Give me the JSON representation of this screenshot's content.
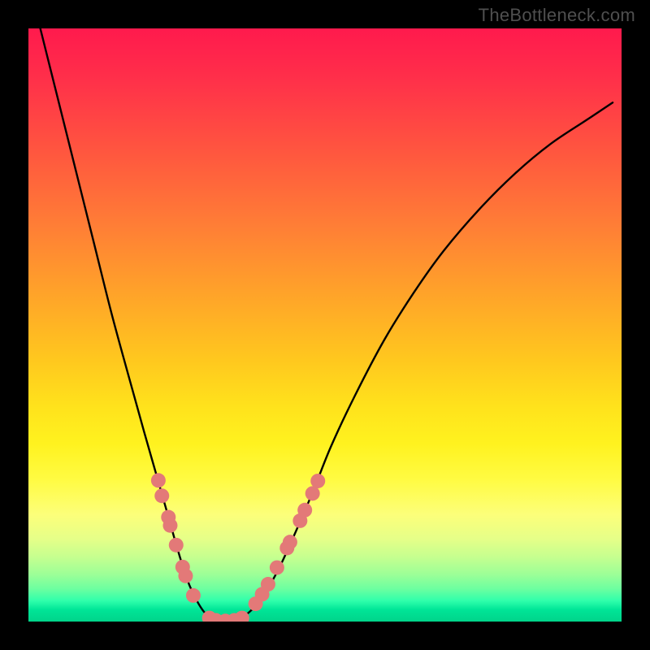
{
  "watermark": "TheBottleneck.com",
  "chart_data": {
    "type": "line",
    "title": "",
    "xlabel": "",
    "ylabel": "",
    "xlim": [
      0,
      1
    ],
    "ylim": [
      0,
      1
    ],
    "series": [
      {
        "name": "curve",
        "x": [
          0.02,
          0.05,
          0.08,
          0.11,
          0.14,
          0.17,
          0.195,
          0.215,
          0.235,
          0.252,
          0.268,
          0.284,
          0.3,
          0.32,
          0.345,
          0.365,
          0.39,
          0.42,
          0.45,
          0.48,
          0.51,
          0.55,
          0.6,
          0.65,
          0.7,
          0.76,
          0.82,
          0.88,
          0.94,
          0.985
        ],
        "y": [
          1.0,
          0.88,
          0.76,
          0.64,
          0.52,
          0.41,
          0.32,
          0.25,
          0.18,
          0.12,
          0.07,
          0.035,
          0.012,
          0.001,
          0.001,
          0.01,
          0.035,
          0.085,
          0.15,
          0.22,
          0.295,
          0.38,
          0.475,
          0.555,
          0.625,
          0.695,
          0.755,
          0.805,
          0.845,
          0.875
        ]
      }
    ],
    "markers": {
      "left_cluster": [
        {
          "x": 0.219,
          "y": 0.238
        },
        {
          "x": 0.225,
          "y": 0.212
        },
        {
          "x": 0.236,
          "y": 0.176
        },
        {
          "x": 0.239,
          "y": 0.162
        },
        {
          "x": 0.249,
          "y": 0.129
        },
        {
          "x": 0.26,
          "y": 0.092
        },
        {
          "x": 0.265,
          "y": 0.077
        },
        {
          "x": 0.278,
          "y": 0.044
        }
      ],
      "bottom_cluster": [
        {
          "x": 0.305,
          "y": 0.006
        },
        {
          "x": 0.316,
          "y": 0.002
        },
        {
          "x": 0.332,
          "y": 0.001
        },
        {
          "x": 0.347,
          "y": 0.002
        },
        {
          "x": 0.36,
          "y": 0.006
        }
      ],
      "right_cluster": [
        {
          "x": 0.383,
          "y": 0.03
        },
        {
          "x": 0.394,
          "y": 0.046
        },
        {
          "x": 0.404,
          "y": 0.063
        },
        {
          "x": 0.419,
          "y": 0.091
        },
        {
          "x": 0.436,
          "y": 0.124
        },
        {
          "x": 0.441,
          "y": 0.134
        },
        {
          "x": 0.458,
          "y": 0.17
        },
        {
          "x": 0.466,
          "y": 0.188
        },
        {
          "x": 0.479,
          "y": 0.216
        },
        {
          "x": 0.488,
          "y": 0.237
        }
      ]
    },
    "marker_color": "#e37978",
    "marker_radius_px": 9,
    "gradient_stops": [
      {
        "pos": 0.0,
        "color": "#ff1a4d"
      },
      {
        "pos": 0.22,
        "color": "#ff5a3e"
      },
      {
        "pos": 0.45,
        "color": "#ffa429"
      },
      {
        "pos": 0.7,
        "color": "#fff21f"
      },
      {
        "pos": 0.92,
        "color": "#9dff97"
      },
      {
        "pos": 1.0,
        "color": "#00d48a"
      }
    ]
  }
}
